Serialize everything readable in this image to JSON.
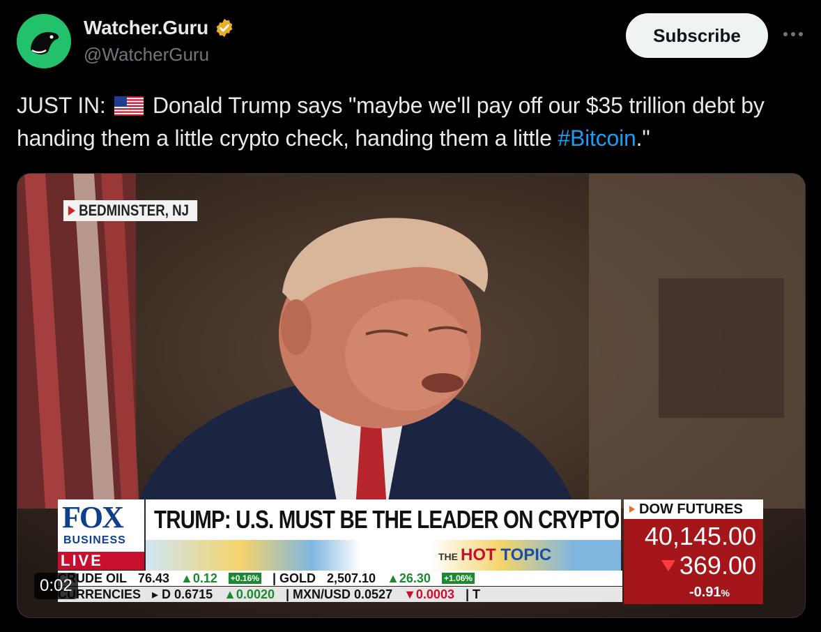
{
  "author": {
    "display_name": "Watcher.Guru",
    "handle": "@WatcherGuru",
    "verified": true,
    "avatar_color": "#23c16b",
    "verified_color": "#e8b02a"
  },
  "actions": {
    "subscribe_label": "Subscribe",
    "more_icon": "more-horizontal-icon"
  },
  "tweet": {
    "prefix": "JUST IN:",
    "flag_icon": "us-flag-emoji",
    "body": "Donald Trump says \"maybe we'll pay off our $35 trillion debt by handing them a little crypto check, handing them a little ",
    "hashtag": "#Bitcoin",
    "suffix": ".\"",
    "hashtag_color": "#1d9bf0"
  },
  "video": {
    "timestamp": "0:02",
    "location_tag": "BEDMINSTER, NJ",
    "network_logo": "FOX",
    "network_sub": "BUSINESS",
    "live_label": "LIVE",
    "headline": "TRUMP: U.S. MUST BE THE LEADER ON CRYPTO",
    "segment_the": "THE",
    "segment_hot": "HOT",
    "segment_topic": "TOPIC",
    "dow": {
      "title": "DOW FUTURES",
      "value": "40,145.00",
      "change": "369.00",
      "pct": "-0.91",
      "pct_unit": "%"
    },
    "ticker_row1": [
      {
        "label": "CRUDE OIL",
        "cls": ""
      },
      {
        "label": "76.43",
        "cls": ""
      },
      {
        "label": "▲0.12",
        "cls": "up"
      },
      {
        "label": "+0.16%",
        "cls": "chip"
      },
      {
        "label": "| GOLD",
        "cls": ""
      },
      {
        "label": "2,507.10",
        "cls": ""
      },
      {
        "label": "▲26.30",
        "cls": "up"
      },
      {
        "label": "+1.06%",
        "cls": "chip"
      }
    ],
    "ticker_row2": [
      {
        "label": "CURRENCIES",
        "cls": ""
      },
      {
        "label": "▸ D 0.6715",
        "cls": ""
      },
      {
        "label": "▲0.0020",
        "cls": "up"
      },
      {
        "label": "| MXN/USD 0.0527",
        "cls": ""
      },
      {
        "label": "▼0.0003",
        "cls": "dn"
      },
      {
        "label": "| T",
        "cls": ""
      }
    ]
  }
}
